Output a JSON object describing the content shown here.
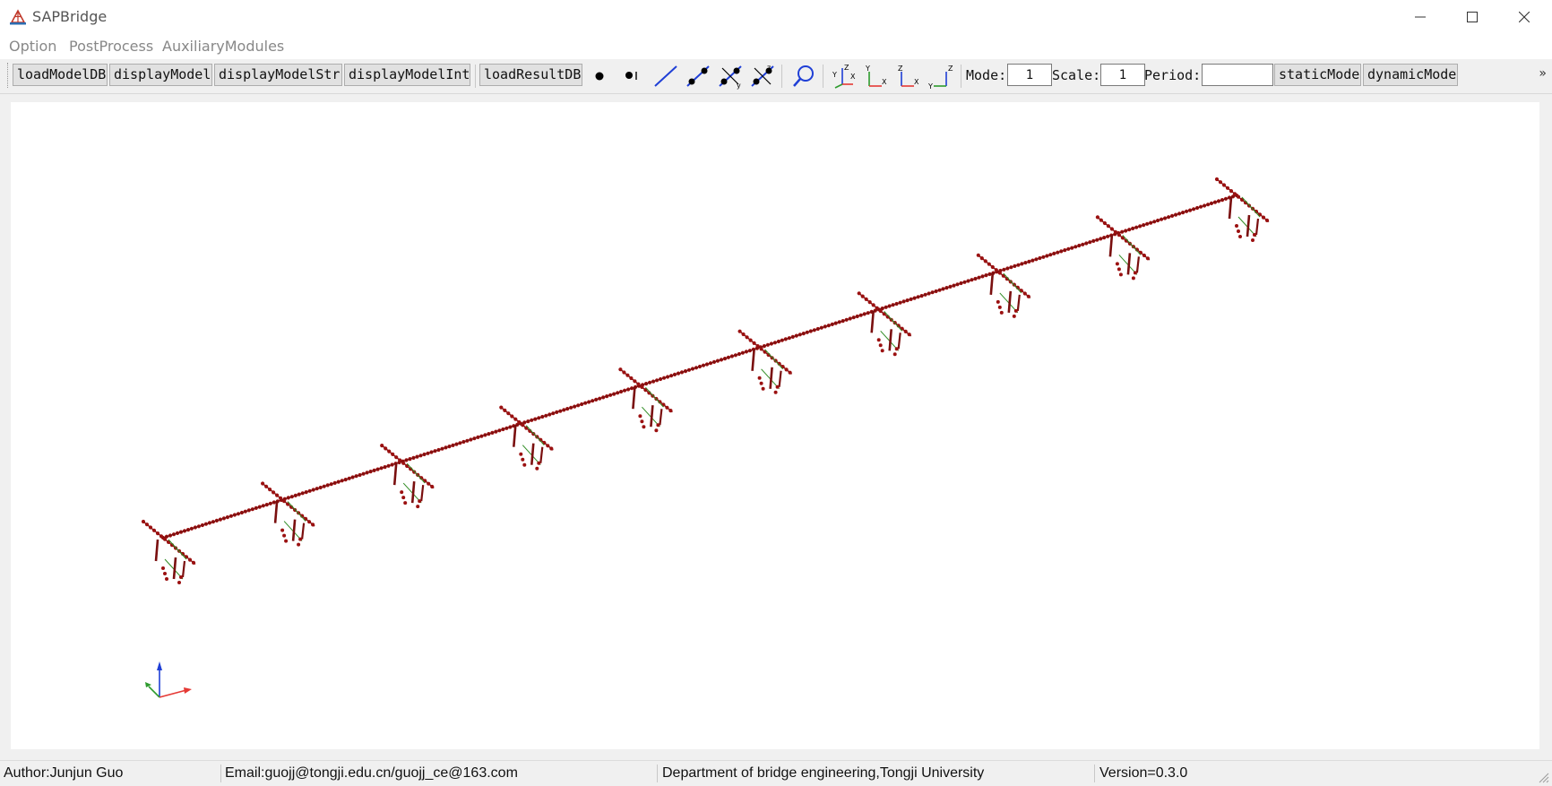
{
  "window": {
    "title": "SAPBridge"
  },
  "menu": {
    "items": [
      "Option",
      "PostProcess",
      "AuxiliaryModules"
    ]
  },
  "toolbar": {
    "buttons": [
      "loadModelDB",
      "displayModel",
      "displayModelStr",
      "displayModelInt",
      "loadResultDB"
    ],
    "mode_label": "Mode:",
    "mode_value": "1",
    "scale_label": "Scale:",
    "scale_value": "1",
    "period_label": "Period:",
    "period_value": "",
    "static_mode": "staticMode",
    "dynamic_mode": "dynamicMode",
    "icons": [
      "node-icon",
      "node-label-icon",
      "element-line-icon",
      "element-with-nodes-icon",
      "local-axis-y-icon",
      "local-axis-z-icon",
      "zoom-icon",
      "view-3d-icon",
      "view-xy-icon",
      "view-xz-icon",
      "view-yz-icon"
    ]
  },
  "viewport": {
    "model": "bridge-model",
    "colors": {
      "nodes": "#9b1111",
      "members": "#7a0f0f",
      "links": "#2e8b22",
      "axis_x": "#e53935",
      "axis_y": "#2e9b2e",
      "axis_z": "#1f3fd6"
    }
  },
  "status": {
    "author": "Author:Junjun Guo",
    "email": "Email:guojj@tongji.edu.cn/guojj_ce@163.com",
    "department": "Department of bridge engineering,Tongji University",
    "version": "Version=0.3.0"
  }
}
